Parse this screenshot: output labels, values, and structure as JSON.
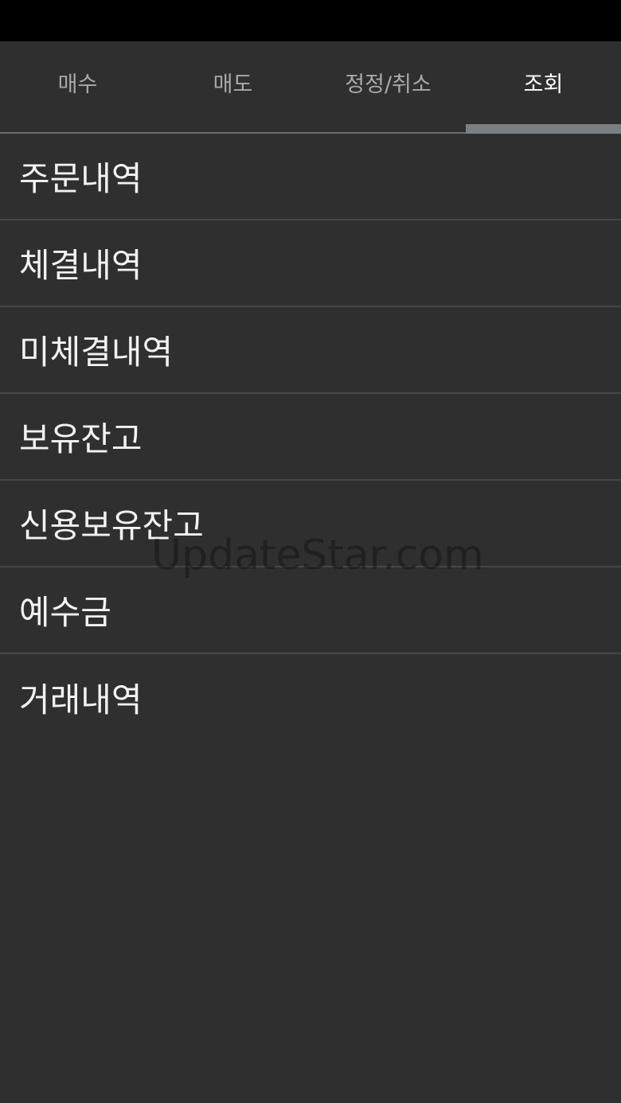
{
  "tabs": [
    {
      "label": "매수",
      "active": false
    },
    {
      "label": "매도",
      "active": false
    },
    {
      "label": "정정/취소",
      "active": false
    },
    {
      "label": "조회",
      "active": true
    }
  ],
  "menu": {
    "items": [
      {
        "label": "주문내역"
      },
      {
        "label": "체결내역"
      },
      {
        "label": "미체결내역"
      },
      {
        "label": "보유잔고"
      },
      {
        "label": "신용보유잔고"
      },
      {
        "label": "예수금"
      },
      {
        "label": "거래내역"
      }
    ]
  },
  "watermark": "UpdateStar.com",
  "colors": {
    "background": "#2f2f2f",
    "status_bar": "#000000",
    "tab_text_inactive": "#a9a9a9",
    "tab_text_active": "#ffffff",
    "tab_indicator": "#7a7f83",
    "divider": "#474747"
  }
}
